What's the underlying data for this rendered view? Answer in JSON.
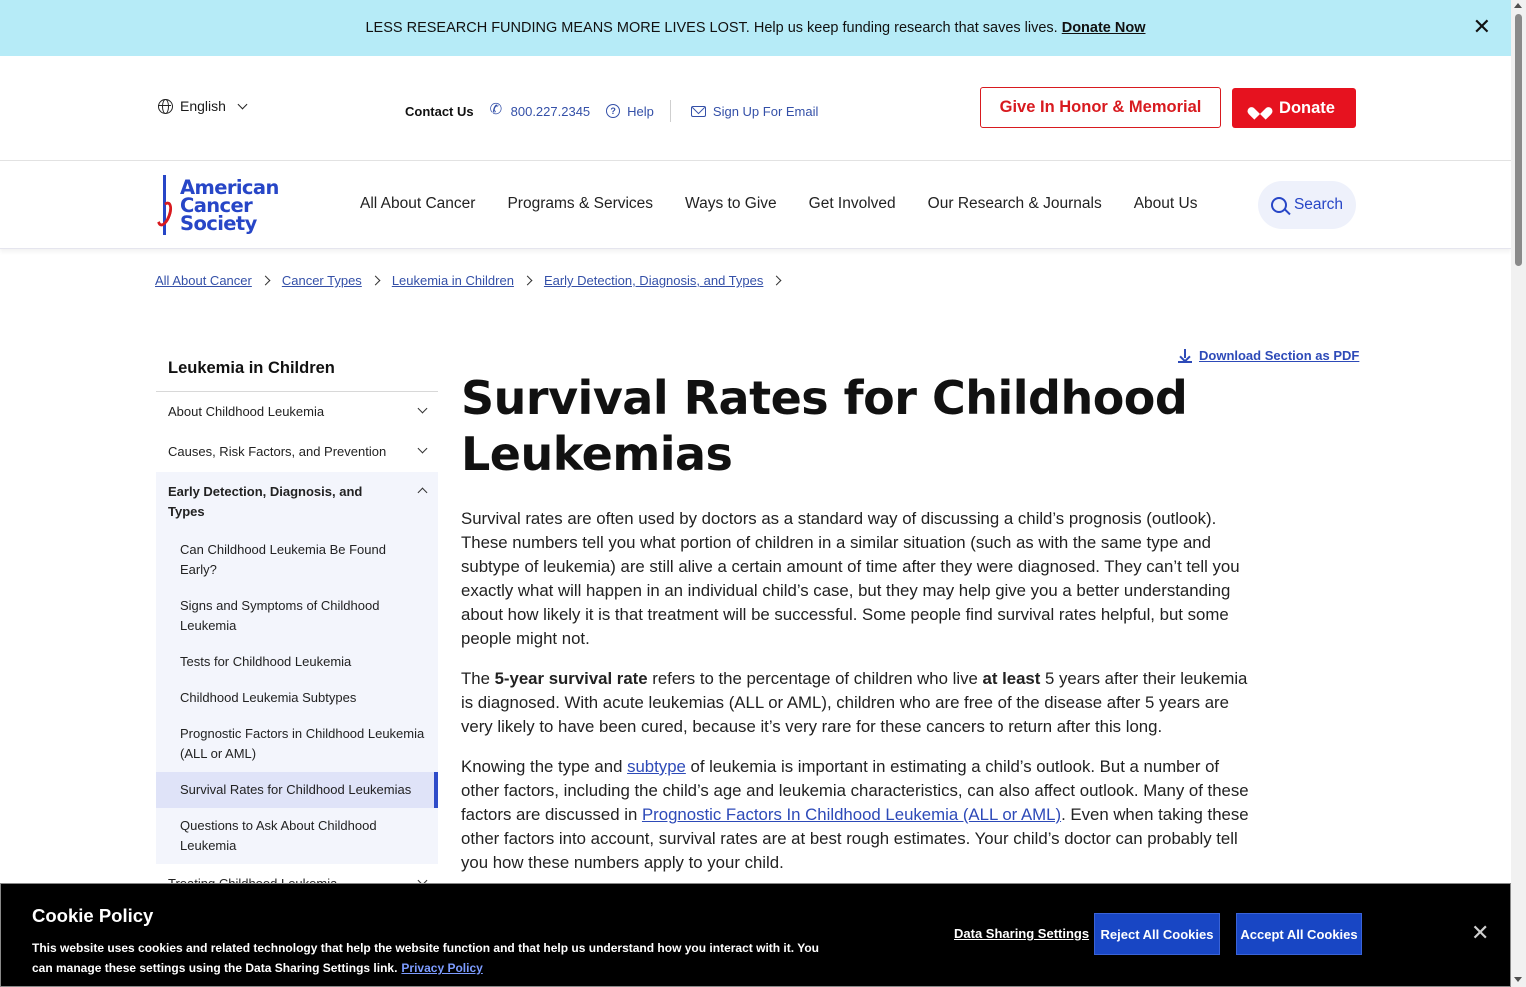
{
  "banner": {
    "message": "LESS RESEARCH FUNDING MEANS MORE LIVES LOST. Help us keep funding research that saves lives.",
    "link": "Donate Now",
    "close": "✕"
  },
  "utility": {
    "language": "English",
    "contact_label": "Contact Us",
    "phone": "800.227.2345",
    "help": "Help",
    "signup": "Sign Up For Email",
    "honor_button": "Give In Honor & Memorial",
    "donate_button": "Donate"
  },
  "logo": {
    "line1": "American",
    "line2": "Cancer",
    "line3": "Society"
  },
  "nav": {
    "items": [
      "All About Cancer",
      "Programs & Services",
      "Ways to Give",
      "Get Involved",
      "Our Research & Journals",
      "About Us"
    ],
    "search": "Search"
  },
  "breadcrumb": [
    "All About Cancer",
    "Cancer Types",
    "Leukemia in Children",
    "Early Detection, Diagnosis, and Types"
  ],
  "sidebar": {
    "title": "Leukemia in Children",
    "sections": [
      "About Childhood Leukemia",
      "Causes, Risk Factors, and Prevention",
      "Early Detection, Diagnosis, and Types",
      "Treating Childhood Leukemia"
    ],
    "subitems": [
      "Can Childhood Leukemia Be Found Early?",
      "Signs and Symptoms of Childhood Leukemia",
      "Tests for Childhood Leukemia",
      "Childhood Leukemia Subtypes",
      "Prognostic Factors in Childhood Leukemia (ALL or AML)",
      "Survival Rates for Childhood Leukemias",
      "Questions to Ask About Childhood Leukemia"
    ]
  },
  "content": {
    "pdf_link": "Download Section as PDF",
    "title": "Survival Rates for Childhood Leukemias",
    "p1": "Survival rates are often used by doctors as a standard way of discussing a child’s prognosis (outlook). These numbers tell you what portion of children in a similar situation (such as with the same type and subtype of leukemia) are still alive a certain amount of time after they were diagnosed. They can’t tell you exactly what will happen in an individual child’s case, but they may help give you a better understanding about how likely it is that treatment will be successful. Some people find survival rates helpful, but some people might not.",
    "p2_a": "The ",
    "p2_b": "5-year survival rate",
    "p2_c": " refers to the percentage of children who live ",
    "p2_d": "at least",
    "p2_e": " 5 years after their leukemia is diagnosed. With acute leukemias (ALL or AML), children who are free of the disease after 5 years are very likely to have been cured, because it’s very rare for these cancers to return after this long.",
    "p3_a": "Knowing the type and ",
    "p3_link1": "subtype",
    "p3_b": " of leukemia is important in estimating a child’s outlook. But a number of other factors, including the child’s age and leukemia characteristics, can also affect outlook. Many of these factors are discussed in ",
    "p3_link2": "Prognostic Factors In Childhood Leukemia (ALL or AML)",
    "p3_c": ". Even when taking these other factors into account, survival rates are at best rough estimates. Your child’s doctor can probably tell you how these numbers apply to your child."
  },
  "cookie": {
    "title": "Cookie Policy",
    "description": "This website uses cookies and related technology that help the website function and that help us understand how you interact with it. You can manage these settings using the Data Sharing Settings link.",
    "privacy_link": "Privacy Policy",
    "settings": "Data Sharing Settings",
    "reject": "Reject All Cookies",
    "accept": "Accept All Cookies",
    "close": "✕"
  }
}
